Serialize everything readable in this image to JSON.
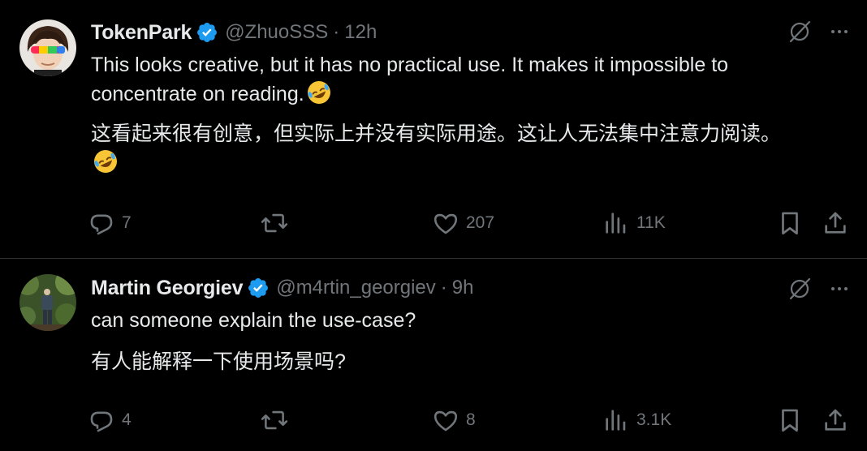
{
  "tweets": [
    {
      "author_name": "TokenPark",
      "handle": "@ZhuoSSS",
      "separator": "·",
      "time": "12h",
      "text_en": "This looks creative, but it has no practical use. It makes it impossible to concentrate on reading.",
      "text_zh": "这看起来很有创意，但实际上并没有实际用途。这让人无法集中注意力阅读。",
      "emoji": "rolling-on-floor-laughing",
      "replies": "7",
      "reposts": "",
      "likes": "207",
      "views": "11K"
    },
    {
      "author_name": "Martin Georgiev",
      "handle": "@m4rtin_georgiev",
      "separator": "·",
      "time": "9h",
      "text_en": "can someone explain the use-case?",
      "text_zh": "有人能解释一下使用场景吗?",
      "replies": "4",
      "reposts": "",
      "likes": "8",
      "views": "3.1K"
    }
  ],
  "icons": {
    "verified": "verified-badge-icon",
    "grok": "grok-icon",
    "more": "more-icon",
    "reply": "reply-icon",
    "repost": "repost-icon",
    "like": "like-icon",
    "views": "views-icon",
    "bookmark": "bookmark-icon",
    "share": "share-icon"
  },
  "colors": {
    "background": "#000000",
    "text": "#e7e9ea",
    "secondary": "#71767b",
    "verified": "#1d9bf0",
    "divider": "#2f3336"
  }
}
